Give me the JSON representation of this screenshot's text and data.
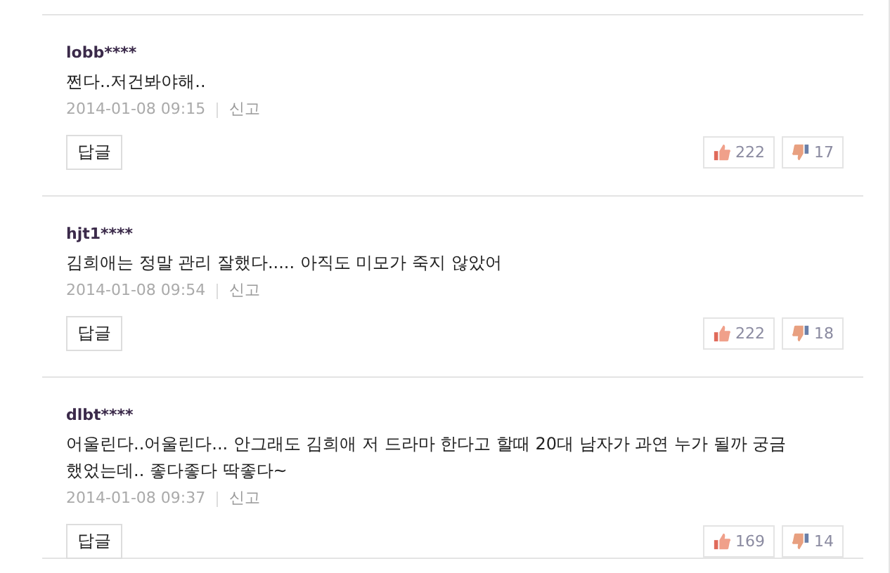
{
  "comments": [
    {
      "user": "lobb****",
      "text": "쩐다..저건봐야해..",
      "date": "2014-01-08 09:15",
      "report": "신고",
      "reply": "답글",
      "likes": "222",
      "dislikes": "17"
    },
    {
      "user": "hjt1****",
      "text": "김희애는 정말 관리 잘했다..... 아직도 미모가 죽지 않았어",
      "date": "2014-01-08 09:54",
      "report": "신고",
      "reply": "답글",
      "likes": "222",
      "dislikes": "18"
    },
    {
      "user": "dlbt****",
      "text": "어울린다..어울린다... 안그래도 김희애 저 드라마 한다고 할때 20대 남자가 과연 누가 될까 궁금했었는데.. 좋다좋다 딱좋다~",
      "date": "2014-01-08 09:37",
      "report": "신고",
      "reply": "답글",
      "likes": "169",
      "dislikes": "14"
    }
  ]
}
